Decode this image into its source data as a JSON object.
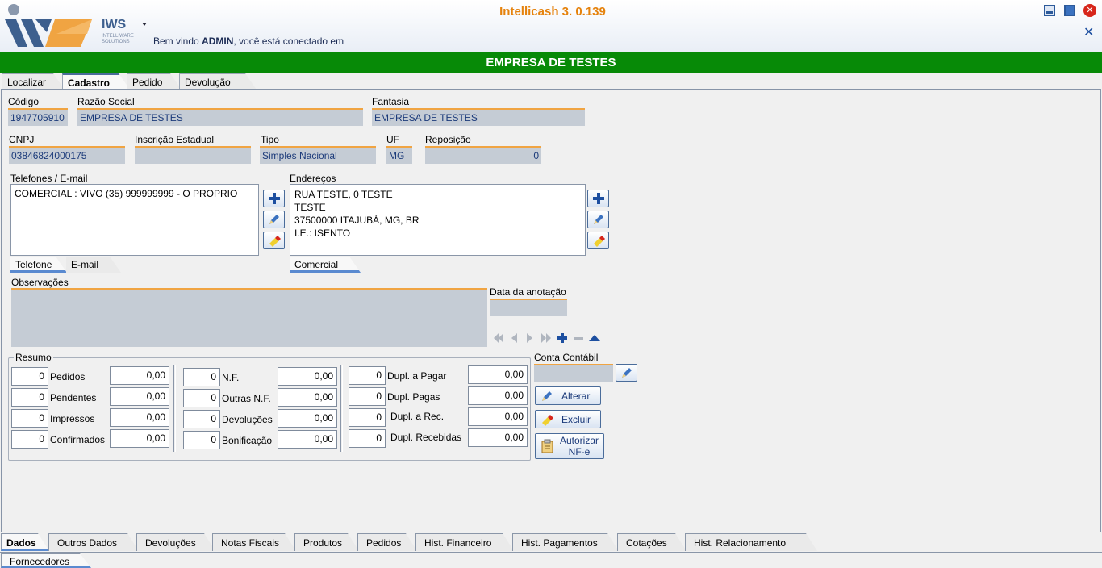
{
  "app": {
    "title": "Intellicash 3. 0.139",
    "logo_text": "IWS",
    "logo_sub": "INTELLIWARE SOLUTIONS",
    "welcome_prefix": "Bem vindo ",
    "welcome_user": "ADMIN",
    "welcome_suffix": ", você está conectado em"
  },
  "company_bar": "EMPRESA DE TESTES",
  "top_tabs": [
    "Localizar",
    "Cadastro",
    "Pedido",
    "Devolução"
  ],
  "fields": {
    "codigo": {
      "label": "Código",
      "value": "1947705910"
    },
    "razao_social": {
      "label": "Razão Social",
      "value": "EMPRESA DE TESTES"
    },
    "fantasia": {
      "label": "Fantasia",
      "value": "EMPRESA DE TESTES"
    },
    "cnpj": {
      "label": "CNPJ",
      "value": "03846824000175"
    },
    "inscricao_estadual": {
      "label": "Inscrição Estadual",
      "value": ""
    },
    "tipo": {
      "label": "Tipo",
      "value": "Simples Nacional"
    },
    "uf": {
      "label": "UF",
      "value": "MG"
    },
    "reposicao": {
      "label": "Reposição",
      "value": "0"
    }
  },
  "telefones": {
    "label": "Telefones / E-mail",
    "items": [
      "COMERCIAL : VIVO (35) 999999999 - O PROPRIO"
    ],
    "tabs": [
      "Telefone",
      "E-mail"
    ]
  },
  "enderecos": {
    "label": "Endereços",
    "lines": [
      "RUA TESTE, 0 TESTE",
      "TESTE",
      "37500000 ITAJUBÁ, MG, BR",
      "I.E.: ISENTO"
    ],
    "tabs": [
      "Comercial"
    ]
  },
  "observacoes": {
    "label": "Observações",
    "value": ""
  },
  "data_anotacao": {
    "label": "Data da anotação",
    "value": ""
  },
  "resumo": {
    "label": "Resumo",
    "col1": [
      {
        "count": "0",
        "label": "Pedidos",
        "value": "0,00"
      },
      {
        "count": "0",
        "label": "Pendentes",
        "value": "0,00"
      },
      {
        "count": "0",
        "label": "Impressos",
        "value": "0,00"
      },
      {
        "count": "0",
        "label": "Confirmados",
        "value": "0,00"
      }
    ],
    "col2": [
      {
        "count": "0",
        "label": "N.F.",
        "value": "0,00"
      },
      {
        "count": "0",
        "label": "Outras N.F.",
        "value": "0,00"
      },
      {
        "count": "0",
        "label": "Devoluções",
        "value": "0,00"
      },
      {
        "count": "0",
        "label": "Bonificação",
        "value": "0,00"
      }
    ],
    "col3": [
      {
        "count": "0",
        "label": "Dupl. a Pagar",
        "value": "0,00"
      },
      {
        "count": "0",
        "label": "Dupl. Pagas",
        "value": "0,00"
      },
      {
        "count": "0",
        "label": "Dupl. a Rec.",
        "value": "0,00"
      },
      {
        "count": "0",
        "label": "Dupl. Recebidas",
        "value": "0,00"
      }
    ]
  },
  "conta_contabil": {
    "label": "Conta Contábil",
    "value": ""
  },
  "actions": {
    "alterar": "Alterar",
    "excluir": "Excluir",
    "autorizar": "Autorizar",
    "autorizar2": "NF-e"
  },
  "bottom_tabs": [
    "Dados",
    "Outros Dados",
    "Devoluções",
    "Notas Fiscais",
    "Produtos",
    "Pedidos",
    "Hist. Financeiro",
    "Hist. Pagamentos",
    "Cotações",
    "Hist. Relacionamento"
  ],
  "footer_tab": "Fornecedores",
  "colors": {
    "brand_green": "#078a07",
    "title_orange": "#e5820c",
    "field_bg": "#c5ccd5",
    "field_underline": "#f0a442"
  }
}
